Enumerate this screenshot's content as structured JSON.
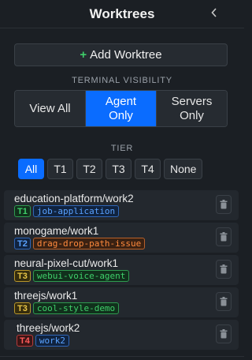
{
  "header": {
    "title": "Worktrees"
  },
  "add_button": {
    "label": "Add Worktree"
  },
  "terminal_visibility": {
    "label": "TERMINAL VISIBILITY",
    "options": [
      {
        "label": "View All",
        "active": false
      },
      {
        "label": "Agent Only",
        "active": true
      },
      {
        "label": "Servers Only",
        "active": false
      }
    ]
  },
  "tier": {
    "label": "TIER",
    "options": [
      {
        "label": "All",
        "active": true
      },
      {
        "label": "T1",
        "active": false
      },
      {
        "label": "T2",
        "active": false
      },
      {
        "label": "T3",
        "active": false
      },
      {
        "label": "T4",
        "active": false
      },
      {
        "label": "None",
        "active": false
      }
    ]
  },
  "worktrees": [
    {
      "name": "education-platform/work2",
      "tier": "T1",
      "branch": "job-application"
    },
    {
      "name": "monogame/work1",
      "tier": "T2",
      "branch": "drag-drop-path-issue"
    },
    {
      "name": "neural-pixel-cut/work1",
      "tier": "T3",
      "branch": "webui-voice-agent"
    },
    {
      "name": "threejs/work1",
      "tier": "T3",
      "branch": "cool-style-demo"
    },
    {
      "name": "threejs/work2",
      "tier": "T4",
      "branch": "work2"
    }
  ],
  "colors": {
    "accent": "#0a6cff",
    "add_plus": "#3fcf6a",
    "tier_tag": {
      "T1": {
        "fg": "#3fcf6a",
        "bg": "#11301c",
        "border": "#2e9a4f"
      },
      "T2": {
        "fg": "#5aa2ff",
        "bg": "#10233f",
        "border": "#2f66b8"
      },
      "T3": {
        "fg": "#e8c547",
        "bg": "#352c0d",
        "border": "#b8962a"
      },
      "T4": {
        "fg": "#ff5a5a",
        "bg": "#3a1515",
        "border": "#b83a3a"
      }
    },
    "branch_tag": {
      "job-application": {
        "fg": "#5aa2ff",
        "bg": "#10233f",
        "border": "#2f66b8"
      },
      "drag-drop-path-issue": {
        "fg": "#ff8a3d",
        "bg": "#3a2112",
        "border": "#b8612a"
      },
      "webui-voice-agent": {
        "fg": "#3fcf6a",
        "bg": "#11301c",
        "border": "#2e9a4f"
      },
      "cool-style-demo": {
        "fg": "#3fcf6a",
        "bg": "#11301c",
        "border": "#2e9a4f"
      },
      "work2": {
        "fg": "#5aa2ff",
        "bg": "#10233f",
        "border": "#2f66b8"
      }
    }
  },
  "icons": {
    "collapse": "chevron-left-icon",
    "add": "plus-icon",
    "delete": "trash-icon"
  }
}
